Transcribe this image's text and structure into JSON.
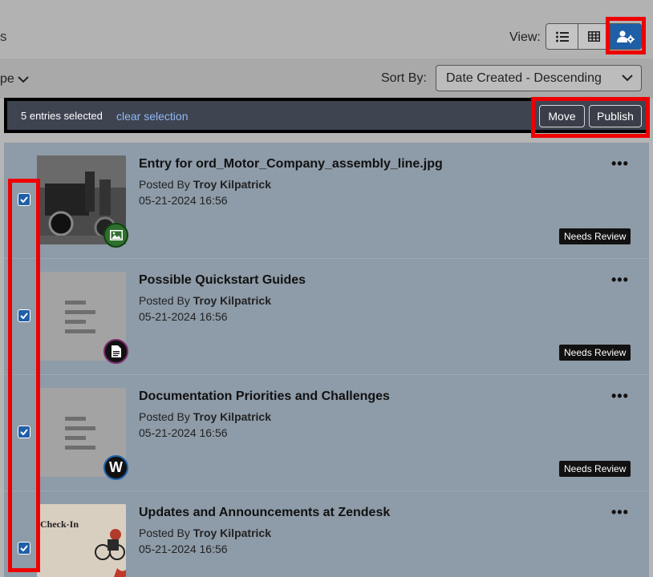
{
  "header": {
    "title_fragment": "s",
    "view_label": "View:",
    "view_buttons": [
      {
        "icon": "list-icon",
        "active": false
      },
      {
        "icon": "grid-icon",
        "active": false
      },
      {
        "icon": "user-gear-icon",
        "active": true
      }
    ]
  },
  "filters": {
    "type_fragment": "pe",
    "sort_label": "Sort By:",
    "sort_value": "Date Created - Descending"
  },
  "selection": {
    "count_text": "5 entries selected",
    "clear_label": "clear selection",
    "move_label": "Move",
    "publish_label": "Publish"
  },
  "entries": [
    {
      "title": "Entry for ord_Motor_Company_assembly_line.jpg",
      "posted_prefix": "Posted By",
      "author": "Troy Kilpatrick",
      "date": "05-21-2024 16:56",
      "status": "Needs Review",
      "type_icon": "image-icon",
      "checked": true
    },
    {
      "title": "Possible Quickstart Guides",
      "posted_prefix": "Posted By",
      "author": "Troy Kilpatrick",
      "date": "05-21-2024 16:56",
      "status": "Needs Review",
      "type_icon": "document-icon",
      "checked": true
    },
    {
      "title": "Documentation Priorities and Challenges",
      "posted_prefix": "Posted By",
      "author": "Troy Kilpatrick",
      "date": "05-21-2024 16:56",
      "status": "Needs Review",
      "type_icon": "word-icon",
      "type_letter": "W",
      "checked": true
    },
    {
      "title": "Updates and Announcements at Zendesk",
      "posted_prefix": "Posted By",
      "author": "Troy Kilpatrick",
      "date": "05-21-2024 16:56",
      "thumb_caption": "Check-In",
      "checked": true
    }
  ],
  "colors": {
    "accent": "#1f5fa8",
    "highlight": "#e00000",
    "selection_bar": "#3f4451"
  }
}
